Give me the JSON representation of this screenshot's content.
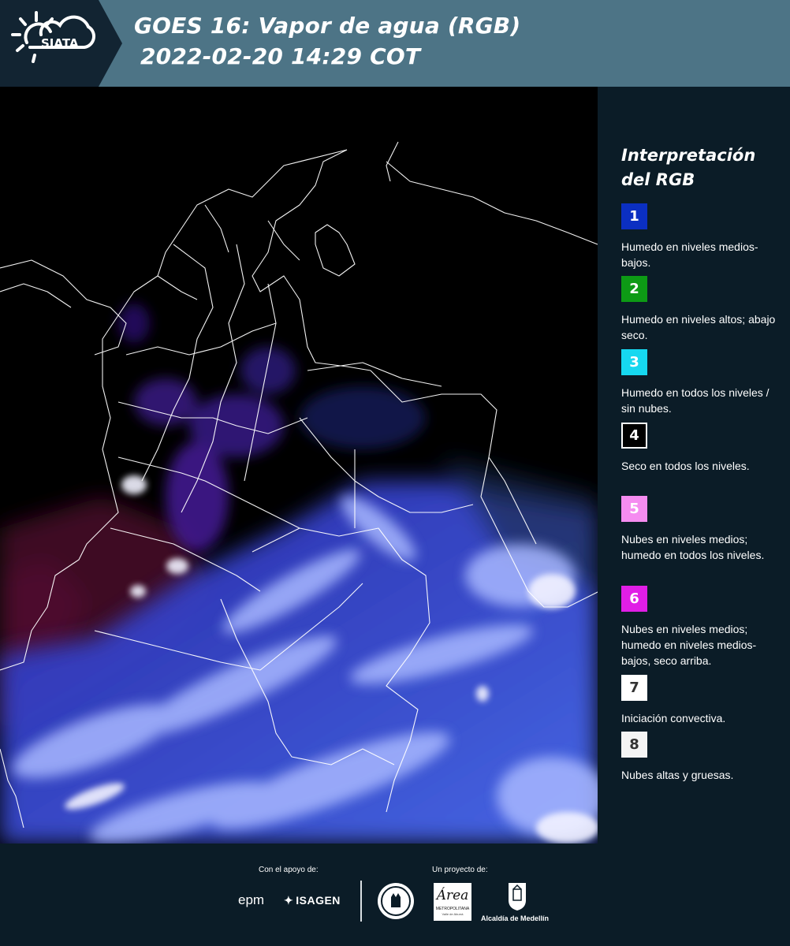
{
  "header": {
    "logo_text": "SIATA",
    "title_line1": "GOES 16: Vapor de agua (RGB)",
    "title_line2": "2022-02-20 14:29 COT",
    "colors": {
      "band_dark": "#122432",
      "band_light": "#4d7486"
    }
  },
  "legend": {
    "title": "Interpretación del RGB",
    "items": [
      {
        "number": "1",
        "color": "#0b2fc2",
        "text_color": "#ffffff",
        "text": "Humedo en niveles medios-bajos."
      },
      {
        "number": "2",
        "color": "#0d9a15",
        "text_color": "#ffffff",
        "text": "Humedo en niveles altos; abajo seco."
      },
      {
        "number": "3",
        "color": "#16d8f0",
        "text_color": "#ffffff",
        "text": "Humedo en todos los niveles / sin nubes."
      },
      {
        "number": "4",
        "color": "#000000",
        "text_color": "#ffffff",
        "text": "Seco en todos los niveles."
      },
      {
        "number": "5",
        "color": "#f58cf0",
        "text_color": "#ffffff",
        "text": "Nubes en niveles medios; humedo en todos los niveles."
      },
      {
        "number": "6",
        "color": "#e01ee6",
        "text_color": "#ffffff",
        "text": "Nubes en niveles medios; humedo en niveles medios-bajos, seco arriba."
      },
      {
        "number": "7",
        "color": "#ffffff",
        "text_color": "#333333",
        "text": "Iniciación convectiva."
      },
      {
        "number": "8",
        "color": "#f4f4f4",
        "text_color": "#333333",
        "text": "Nubes altas y gruesas."
      }
    ]
  },
  "footer": {
    "support_label": "Con el apoyo de:",
    "project_label": "Un proyecto de:",
    "sponsors": [
      "epm",
      "ISAGEN"
    ],
    "partners": [
      "Antioquia",
      "Área Metropolitana",
      "Alcaldía de Medellín"
    ],
    "area_logo_text": "Área",
    "area_caption": "METROPOLITANA",
    "area_subcaption": "Valle de Aburrá",
    "alcaldia_text": "Alcaldía de Medellín"
  }
}
